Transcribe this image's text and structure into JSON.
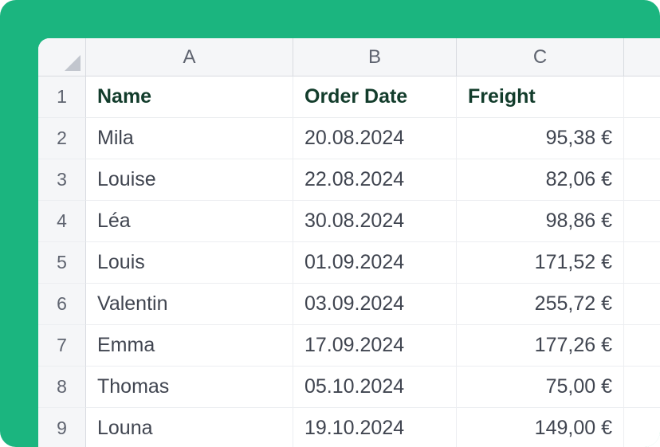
{
  "columns": {
    "a": "A",
    "b": "B",
    "c": "C"
  },
  "rowNumbers": [
    "1",
    "2",
    "3",
    "4",
    "5",
    "6",
    "7",
    "8",
    "9"
  ],
  "header": {
    "name": "Name",
    "orderDate": "Order Date",
    "freight": "Freight"
  },
  "rows": [
    {
      "name": "Mila",
      "orderDate": "20.08.2024",
      "freight": "95,38 €"
    },
    {
      "name": "Louise",
      "orderDate": "22.08.2024",
      "freight": "82,06 €"
    },
    {
      "name": "Léa",
      "orderDate": "30.08.2024",
      "freight": "98,86 €"
    },
    {
      "name": "Louis",
      "orderDate": "01.09.2024",
      "freight": "171,52 €"
    },
    {
      "name": "Valentin",
      "orderDate": "03.09.2024",
      "freight": "255,72 €"
    },
    {
      "name": "Emma",
      "orderDate": "17.09.2024",
      "freight": "177,26 €"
    },
    {
      "name": "Thomas",
      "orderDate": "05.10.2024",
      "freight": "75,00 €"
    },
    {
      "name": "Louna",
      "orderDate": "19.10.2024",
      "freight": "149,00 €"
    }
  ]
}
